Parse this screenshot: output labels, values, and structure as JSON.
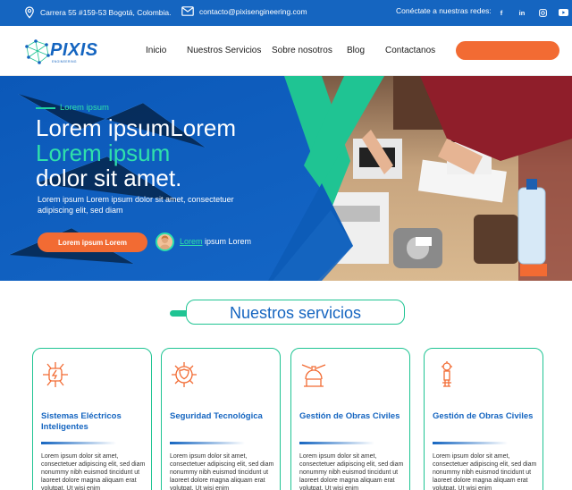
{
  "topbar": {
    "address": "Carrera 55 #159-53 Bogotá, Colombia.",
    "email": "contacto@pixisengineering.com",
    "social_label": "Conéctate a nuestras redes:",
    "social_icons": [
      "facebook-icon",
      "linkedin-icon",
      "instagram-icon",
      "youtube-icon"
    ]
  },
  "nav": {
    "logo_text": "PIXIS",
    "logo_sub": "ENGINEERING",
    "items": [
      "Inicio",
      "Nuestros Servicios",
      "Sobre nosotros",
      "Blog",
      "Contactanos"
    ],
    "cta_label": ""
  },
  "hero": {
    "eyebrow": "Lorem ipsum",
    "line1": "Lorem ipsumLorem",
    "line2": "Lorem ipsum",
    "line3": "dolor sit amet.",
    "paragraph": "Lorem ipsum Lorem ipsum dolor sit amet, consectetuer adipiscing elit, sed diam",
    "button": "Lorem ipsum Lorem",
    "link_underlined": "Lorem",
    "link_rest": " ipsum Lorem"
  },
  "services": {
    "title": "Nuestros servicios",
    "cards": [
      {
        "icon": "electric-icon",
        "title": "Sistemas Eléctricos Inteligentes",
        "text": "Lorem ipsum dolor sit amet, consectetuer adipiscing elit, sed diam nonummy nibh euismod tincidunt ut laoreet dolore magna aliquam erat volutpat. Ut wisi enim"
      },
      {
        "icon": "shield-chip-icon",
        "title": "Seguridad Tecnológica",
        "text": "Lorem ipsum dolor sit amet, consectetuer adipiscing elit, sed diam nonummy nibh euismod tincidunt ut laoreet dolore magna aliquam erat volutpat. Ut wisi enim"
      },
      {
        "icon": "construction-icon",
        "title": "Gestión de Obras Civiles",
        "text": "Lorem ipsum dolor sit amet, consectetuer adipiscing elit, sed diam nonummy nibh euismod tincidunt ut laoreet dolore magna aliquam erat volutpat. Ut wisi enim"
      },
      {
        "icon": "tower-icon",
        "title": "Gestión de Obras Civiles",
        "text": "Lorem ipsum dolor sit amet, consectetuer adipiscing elit, sed diam nonummy nibh euismod tincidunt ut laoreet dolore magna aliquam erat volutpat. Ut wisi enim"
      }
    ]
  },
  "colors": {
    "primary_blue": "#1565c0",
    "accent_green": "#1fc493",
    "accent_orange": "#f26b33"
  }
}
